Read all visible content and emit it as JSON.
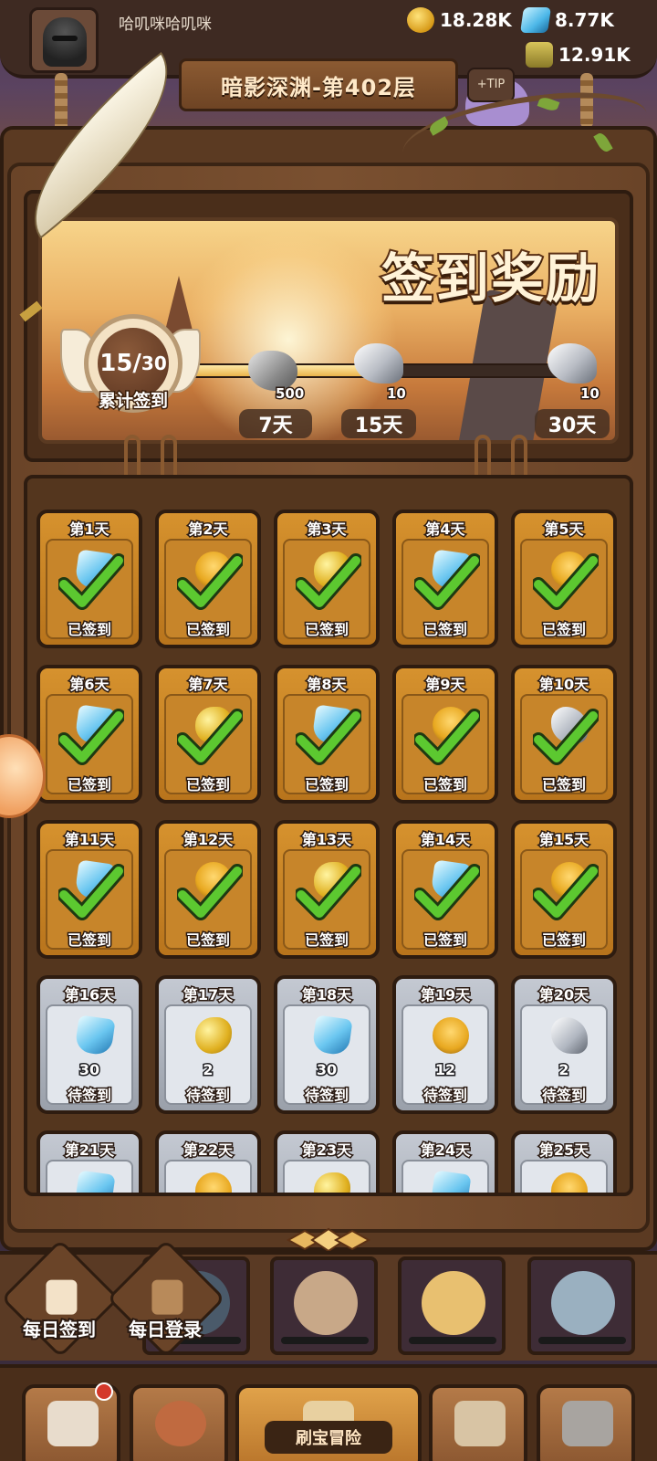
{
  "player": {
    "name": "哈叽咪哈叽咪"
  },
  "resources": [
    {
      "name": "coins",
      "value": "18.28K",
      "icon": "gold-coin-icon"
    },
    {
      "name": "gems",
      "value": "8.77K",
      "icon": "blue-gem-icon"
    },
    {
      "name": "potion",
      "value": "12.91K",
      "icon": "potion-jar-icon"
    }
  ],
  "floor": {
    "title": "暗影深渊-第402层"
  },
  "checkin": {
    "banner_title": "签到奖励",
    "progress": {
      "current": "15",
      "total": "30",
      "label": "累计签到",
      "fraction": 0.5
    },
    "milestones": [
      {
        "qty": "500",
        "day": "7天",
        "item": "stone"
      },
      {
        "qty": "10",
        "day": "15天",
        "item": "silver-scroll"
      },
      {
        "qty": "10",
        "day": "30天",
        "item": "silver-scroll"
      }
    ],
    "days": [
      {
        "title": "第1天",
        "status": "已签到",
        "done": true,
        "item": "gem",
        "qty": ""
      },
      {
        "title": "第2天",
        "status": "已签到",
        "done": true,
        "item": "hero",
        "qty": ""
      },
      {
        "title": "第3天",
        "status": "已签到",
        "done": true,
        "item": "gold",
        "qty": ""
      },
      {
        "title": "第4天",
        "status": "已签到",
        "done": true,
        "item": "gem",
        "qty": ""
      },
      {
        "title": "第5天",
        "status": "已签到",
        "done": true,
        "item": "hero",
        "qty": ""
      },
      {
        "title": "第6天",
        "status": "已签到",
        "done": true,
        "item": "gem",
        "qty": ""
      },
      {
        "title": "第7天",
        "status": "已签到",
        "done": true,
        "item": "gold",
        "qty": ""
      },
      {
        "title": "第8天",
        "status": "已签到",
        "done": true,
        "item": "gem",
        "qty": ""
      },
      {
        "title": "第9天",
        "status": "已签到",
        "done": true,
        "item": "hero",
        "qty": ""
      },
      {
        "title": "第10天",
        "status": "已签到",
        "done": true,
        "item": "scroll",
        "qty": ""
      },
      {
        "title": "第11天",
        "status": "已签到",
        "done": true,
        "item": "gem",
        "qty": ""
      },
      {
        "title": "第12天",
        "status": "已签到",
        "done": true,
        "item": "hero",
        "qty": ""
      },
      {
        "title": "第13天",
        "status": "已签到",
        "done": true,
        "item": "gold",
        "qty": ""
      },
      {
        "title": "第14天",
        "status": "已签到",
        "done": true,
        "item": "gem",
        "qty": ""
      },
      {
        "title": "第15天",
        "status": "已签到",
        "done": true,
        "item": "hero",
        "qty": ""
      },
      {
        "title": "第16天",
        "status": "待签到",
        "done": false,
        "item": "gem",
        "qty": "30"
      },
      {
        "title": "第17天",
        "status": "待签到",
        "done": false,
        "item": "gold",
        "qty": "2"
      },
      {
        "title": "第18天",
        "status": "待签到",
        "done": false,
        "item": "gem",
        "qty": "30"
      },
      {
        "title": "第19天",
        "status": "待签到",
        "done": false,
        "item": "hero",
        "qty": "12"
      },
      {
        "title": "第20天",
        "status": "待签到",
        "done": false,
        "item": "scroll",
        "qty": "2"
      },
      {
        "title": "第21天",
        "status": "",
        "done": false,
        "item": "gem",
        "qty": ""
      },
      {
        "title": "第22天",
        "status": "",
        "done": false,
        "item": "hero",
        "qty": ""
      },
      {
        "title": "第23天",
        "status": "",
        "done": false,
        "item": "gold",
        "qty": ""
      },
      {
        "title": "第24天",
        "status": "",
        "done": false,
        "item": "gem",
        "qty": ""
      },
      {
        "title": "第25天",
        "status": "",
        "done": false,
        "item": "hero",
        "qty": ""
      }
    ]
  },
  "side_buttons": [
    {
      "label": "每日签到",
      "icon": "calendar-check-icon"
    },
    {
      "label": "每日登录",
      "icon": "gift-box-icon"
    }
  ],
  "bottom_nav": {
    "items": [
      {
        "icon": "shop-icon",
        "badge": true
      },
      {
        "icon": "hero-portrait-icon",
        "badge": false
      },
      {
        "icon": "treasure-map-icon",
        "badge": false,
        "label": "刷宝冒险"
      },
      {
        "icon": "backpack-icon",
        "badge": false
      },
      {
        "icon": "hammer-anvil-icon",
        "badge": false
      }
    ]
  },
  "colors": {
    "wood": "#5b3a22",
    "done_card": "#d6922e",
    "todo_card": "#c4c9d2",
    "check_green": "#5cc830"
  }
}
